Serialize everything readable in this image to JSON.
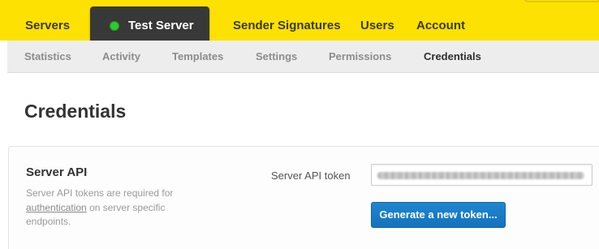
{
  "topnav": {
    "servers": "Servers",
    "current_server": {
      "name": "Test Server",
      "status_color": "#2ecb2e"
    },
    "sender_signatures": "Sender Signatures",
    "users": "Users",
    "account": "Account"
  },
  "subnav": {
    "statistics": "Statistics",
    "activity": "Activity",
    "templates": "Templates",
    "settings": "Settings",
    "permissions": "Permissions",
    "credentials": "Credentials",
    "active": "Credentials"
  },
  "page": {
    "title": "Credentials"
  },
  "server_api": {
    "title": "Server API",
    "desc_before": "Server API tokens are required for ",
    "desc_link": "authentication",
    "desc_after": " on server specific endpoints.",
    "token_label": "Server API token",
    "token_value_obscured": true,
    "generate_button": "Generate a new token..."
  },
  "colors": {
    "brand_yellow": "#fde102",
    "button_blue": "#1a7cc6"
  }
}
